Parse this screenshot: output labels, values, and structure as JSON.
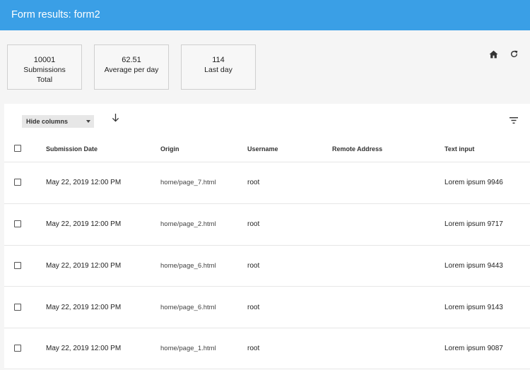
{
  "app": {
    "title": "Form results: form2"
  },
  "stats": [
    {
      "value": "10001",
      "label": "Submissions",
      "sublabel": "Total"
    },
    {
      "value": "62.51",
      "label": "Average per day"
    },
    {
      "value": "114",
      "label": "Last day"
    }
  ],
  "toolbar": {
    "hide_columns_label": "Hide columns"
  },
  "table": {
    "headers": {
      "date": "Submission Date",
      "origin": "Origin",
      "username": "Username",
      "remote": "Remote Address",
      "text": "Text input"
    },
    "rows": [
      {
        "date": "May 22, 2019 12:00 PM",
        "origin": "home/page_7.html",
        "username": "root",
        "remote": "",
        "text": "Lorem ipsum 9946"
      },
      {
        "date": "May 22, 2019 12:00 PM",
        "origin": "home/page_2.html",
        "username": "root",
        "remote": "",
        "text": "Lorem ipsum 9717"
      },
      {
        "date": "May 22, 2019 12:00 PM",
        "origin": "home/page_6.html",
        "username": "root",
        "remote": "",
        "text": "Lorem ipsum 9443"
      },
      {
        "date": "May 22, 2019 12:00 PM",
        "origin": "home/page_6.html",
        "username": "root",
        "remote": "",
        "text": "Lorem ipsum 9143"
      },
      {
        "date": "May 22, 2019 12:00 PM",
        "origin": "home/page_1.html",
        "username": "root",
        "remote": "",
        "text": "Lorem ipsum 9087"
      }
    ]
  },
  "colors": {
    "appbar": "#3a9fe6"
  }
}
